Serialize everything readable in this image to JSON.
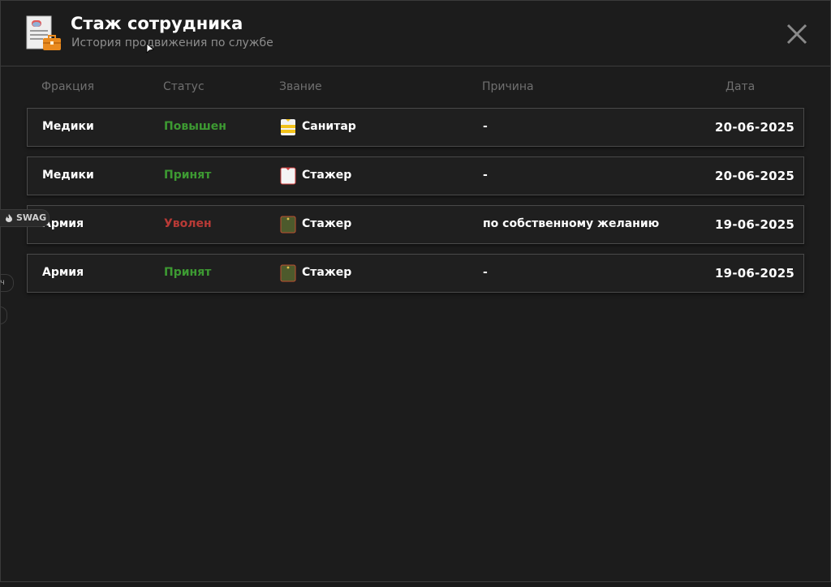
{
  "header": {
    "title": "Стаж сотрудника",
    "subtitle": "История продвижения по службе",
    "icon": "employee-document-icon",
    "close_icon": "close-icon"
  },
  "columns": {
    "faction": "Фракция",
    "status": "Статус",
    "rank": "Звание",
    "reason": "Причина",
    "date": "Дата"
  },
  "rows": [
    {
      "faction": "Медики",
      "status": "Повышен",
      "status_color": "#3d9a32",
      "rank_icon": "medic-rank-yellow-icon",
      "rank": "Санитар",
      "reason": "-",
      "date": "20-06-2025"
    },
    {
      "faction": "Медики",
      "status": "Принят",
      "status_color": "#3d9a32",
      "rank_icon": "medic-rank-white-icon",
      "rank": "Стажер",
      "reason": "-",
      "date": "20-06-2025"
    },
    {
      "faction": "Армия",
      "status": "Уволен",
      "status_color": "#b83a36",
      "rank_icon": "army-rank-green-icon",
      "rank": "Стажер",
      "reason": "по собственному желанию",
      "date": "19-06-2025"
    },
    {
      "faction": "Армия",
      "status": "Принят",
      "status_color": "#3d9a32",
      "rank_icon": "army-rank-green-icon",
      "rank": "Стажер",
      "reason": "-",
      "date": "19-06-2025"
    }
  ],
  "side": {
    "swag_label": "SWAG",
    "frag_label": "ч"
  },
  "colors": {
    "background": "#1c1c1c",
    "positive": "#3d9a32",
    "negative": "#b83a36"
  }
}
